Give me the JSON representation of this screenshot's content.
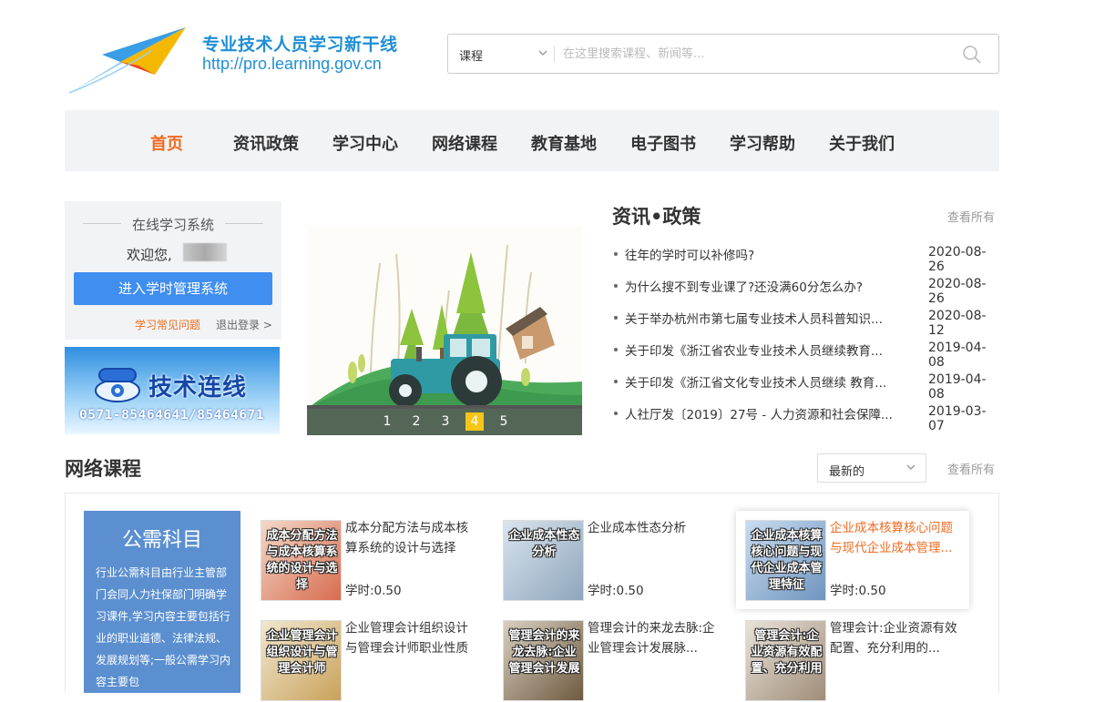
{
  "header": {
    "site_title": "专业技术人员学习新干线",
    "site_url": "http://pro.learning.gov.cn",
    "search": {
      "type_value": "课程",
      "placeholder": "在这里搜索课程、新闻等..."
    }
  },
  "nav": {
    "items": [
      "首页",
      "资讯政策",
      "学习中心",
      "网络课程",
      "教育基地",
      "电子图书",
      "学习帮助",
      "关于我们"
    ],
    "active_index": 0
  },
  "login": {
    "title": "在线学习系统",
    "welcome": "欢迎您,",
    "enter_button": "进入学时管理系统",
    "faq_link": "学习常见问题",
    "logout_link": "退出登录 >"
  },
  "tech_banner": {
    "title": "技术连线",
    "phone": "0571-85464641/85464671"
  },
  "carousel": {
    "pages": [
      "1",
      "2",
      "3",
      "4",
      "5"
    ],
    "active_index": 3
  },
  "news": {
    "title": "资讯•政策",
    "more": "查看所有",
    "items": [
      {
        "title": "往年的学时可以补修吗?",
        "date": "2020-08-26"
      },
      {
        "title": "为什么搜不到专业课了?还没满60分怎么办?",
        "date": "2020-08-26"
      },
      {
        "title": "关于举办杭州市第七届专业技术人员科普知识...",
        "date": "2020-08-12"
      },
      {
        "title": "关于印发《浙江省农业专业技术人员继续教育...",
        "date": "2019-04-08"
      },
      {
        "title": "关于印发《浙江省文化专业技术人员继续 教育...",
        "date": "2019-04-08"
      },
      {
        "title": "人社厅发〔2019〕27号 - 人力资源和社会保障...",
        "date": "2019-03-07"
      }
    ]
  },
  "courses": {
    "title": "网络课程",
    "sort_value": "最新的",
    "more": "查看所有",
    "public_subject": {
      "title": "公需科目",
      "description": "行业公需科目由行业主管部门会同人力社保部门明确学习课件,学习内容主要包括行业的职业道德、法律法规、发展规划等;一般公需学习内容主要包"
    },
    "items": [
      {
        "thumb": "成本分配方法与成本核算系统的设计与选择",
        "title": "成本分配方法与成本核算系统的设计与选择",
        "hours": "学时:0.50",
        "colors": [
          "#f3d9c8",
          "#d86c4f"
        ]
      },
      {
        "thumb": "企业成本性态分析",
        "title": "企业成本性态分析",
        "hours": "学时:0.50",
        "colors": [
          "#d9e4ee",
          "#8fa6bd"
        ]
      },
      {
        "thumb": "企业成本核算核心问题与现代企业成本管理特征",
        "title": "企业成本核算核心问题与现代企业成本管理...",
        "hours": "学时:0.50",
        "colors": [
          "#c8dcf0",
          "#6f95bf"
        ]
      },
      {
        "thumb": "企业管理会计组织设计与管理会计师",
        "title": "企业管理会计组织设计与管理会计师职业性质",
        "hours": "",
        "colors": [
          "#f1e7cf",
          "#c9a25b"
        ]
      },
      {
        "thumb": "管理会计的来龙去脉:企业管理会计发展",
        "title": "管理会计的来龙去脉:企业管理会计发展脉...",
        "hours": "",
        "colors": [
          "#d9cfc0",
          "#6e5a40"
        ]
      },
      {
        "thumb": "管理会计:企业资源有效配置、充分利用",
        "title": "管理会计:企业资源有效配置、充分利用的...",
        "hours": "",
        "colors": [
          "#e9e2d8",
          "#9f8d79"
        ]
      }
    ]
  },
  "colors": {
    "accent": "#ef6b1f",
    "primary_blue": "#3f8ef0",
    "brand_blue": "#1f8fd6",
    "pub_bg": "#5b8fd0"
  }
}
